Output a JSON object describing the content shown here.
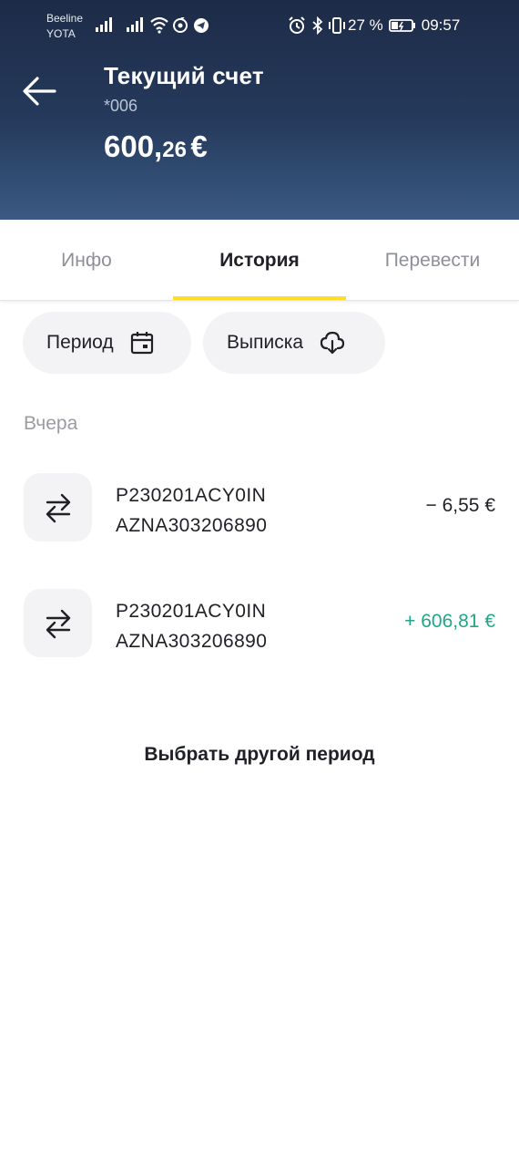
{
  "status_bar": {
    "carrier_1": "Beeline",
    "carrier_2": "YOTA",
    "battery_percent": "27 %",
    "time": "09:57"
  },
  "header": {
    "title": "Текущий счет",
    "account_number": "*006",
    "balance_integer": "600,",
    "balance_fraction": "26",
    "balance_currency": "€"
  },
  "tabs": [
    {
      "label": "Инфо",
      "active": false
    },
    {
      "label": "История",
      "active": true
    },
    {
      "label": "Перевести",
      "active": false
    }
  ],
  "filters": {
    "period_label": "Период",
    "statement_label": "Выписка"
  },
  "history": {
    "group_label": "Вчера",
    "transactions": [
      {
        "line1": "P230201ACY0IN",
        "line2": "AZNA303206890",
        "amount": "− 6,55 €",
        "type": "debit"
      },
      {
        "line1": "P230201ACY0IN",
        "line2": "AZNA303206890",
        "amount": "+ 606,81 €",
        "type": "credit"
      }
    ]
  },
  "other_period_label": "Выбрать другой период",
  "colors": {
    "header_dark": "#1d2b47",
    "header_light": "#3a5a83",
    "accent_yellow": "#ffdd2d",
    "credit_green": "#1ea887",
    "debit_text": "#1f2126"
  }
}
